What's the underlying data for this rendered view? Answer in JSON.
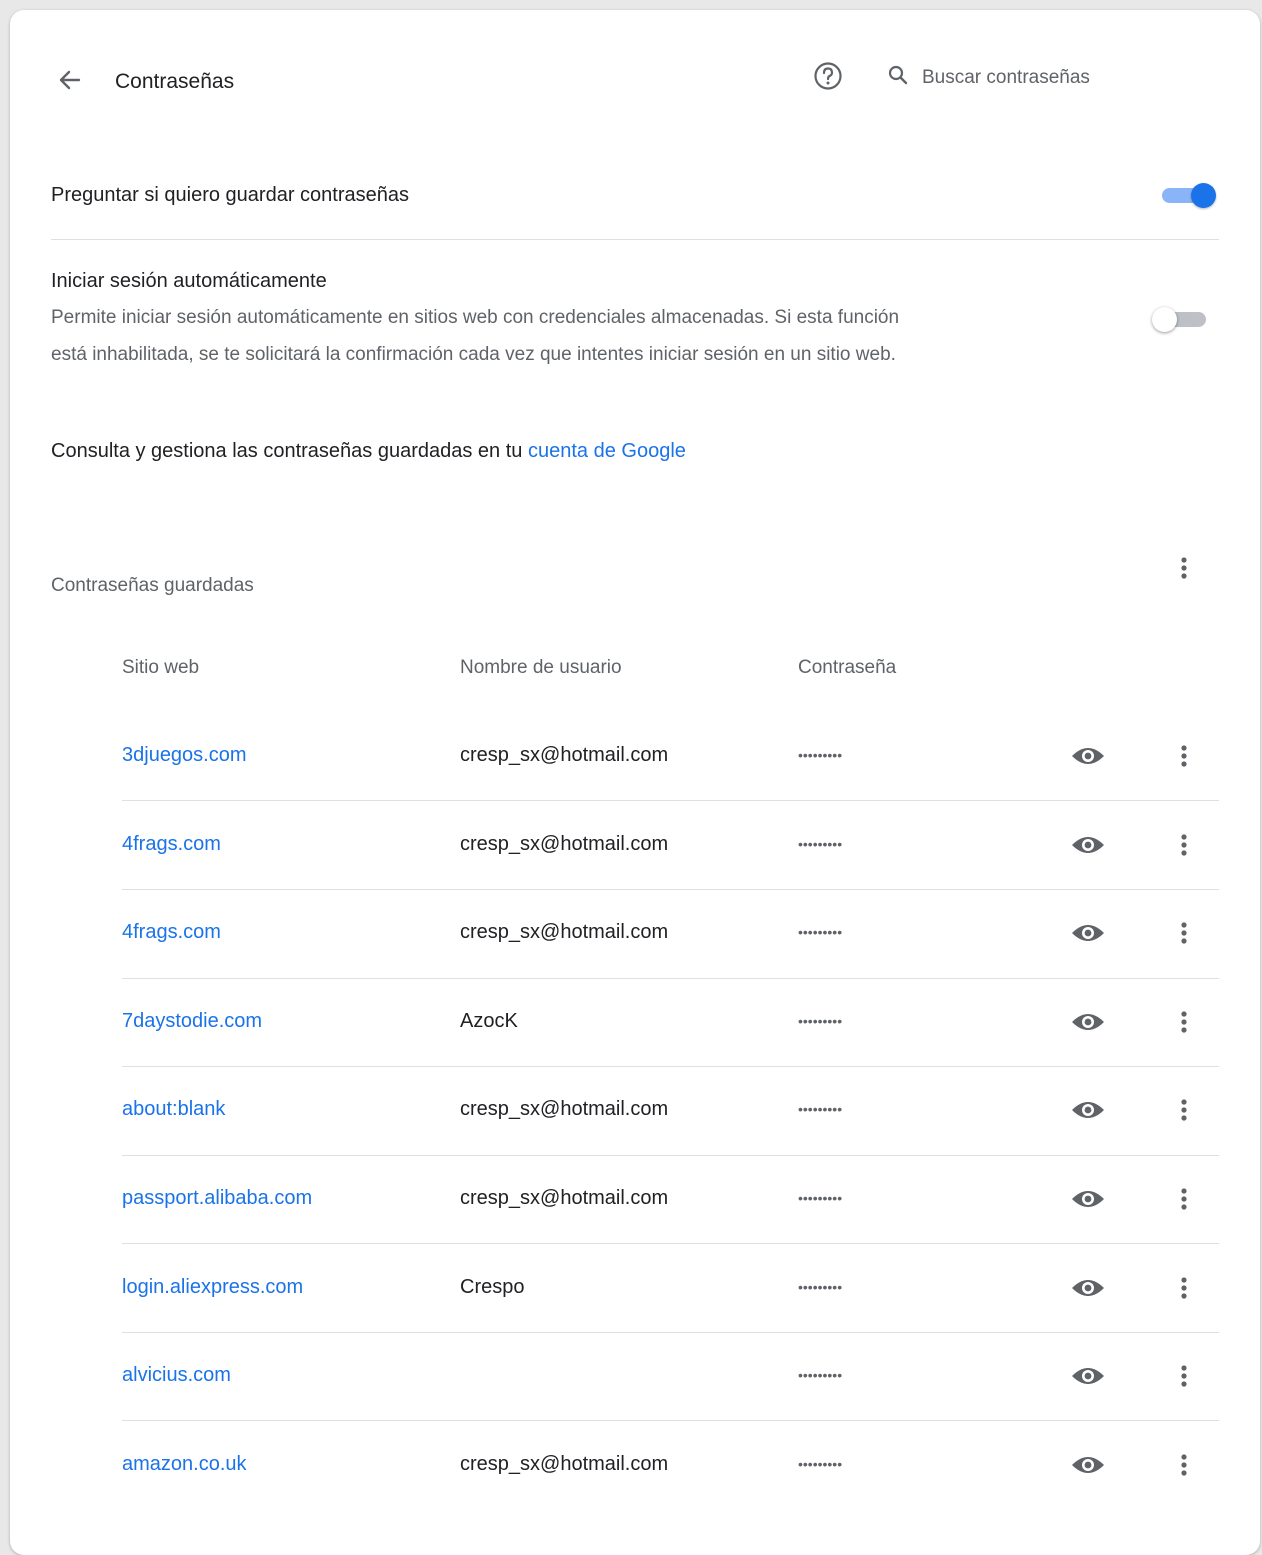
{
  "header": {
    "title": "Contraseñas",
    "search_placeholder": "Buscar contraseñas"
  },
  "settings": {
    "offer_save_label": "Preguntar si quiero guardar contraseñas",
    "offer_save_enabled": true,
    "auto_signin_label": "Iniciar sesión automáticamente",
    "auto_signin_desc_1": "Permite iniciar sesión automáticamente en sitios web con credenciales almacenadas. Si esta función",
    "auto_signin_desc_2": "está inhabilitada, se te solicitará la confirmación cada vez que intentes iniciar sesión en un sitio web.",
    "auto_signin_enabled": false,
    "google_account_text": "Consulta y gestiona las contraseñas guardadas en tu ",
    "google_account_link": "cuenta de Google"
  },
  "saved": {
    "heading": "Contraseñas guardadas",
    "columns": {
      "site": "Sitio web",
      "user": "Nombre de usuario",
      "password": "Contraseña"
    },
    "rows": [
      {
        "site": "3djuegos.com",
        "user": "cresp_sx@hotmail.com",
        "password": "•••••••••"
      },
      {
        "site": "4frags.com",
        "user": "cresp_sx@hotmail.com",
        "password": "•••••••••"
      },
      {
        "site": "4frags.com",
        "user": "cresp_sx@hotmail.com",
        "password": "•••••••••"
      },
      {
        "site": "7daystodie.com",
        "user": "AzocK",
        "password": "•••••••••"
      },
      {
        "site": "about:blank",
        "user": "cresp_sx@hotmail.com",
        "password": "•••••••••"
      },
      {
        "site": "passport.alibaba.com",
        "user": "cresp_sx@hotmail.com",
        "password": "•••••••••"
      },
      {
        "site": "login.aliexpress.com",
        "user": "Crespo",
        "password": "•••••••••"
      },
      {
        "site": "alvicius.com",
        "user": "",
        "password": "•••••••••"
      },
      {
        "site": "amazon.co.uk",
        "user": "cresp_sx@hotmail.com",
        "password": "•••••••••"
      }
    ]
  },
  "icons": {
    "back": "arrow-back-icon",
    "help": "help-circle-icon",
    "search": "search-icon",
    "eye": "eye-icon",
    "more": "more-vert-icon"
  },
  "colors": {
    "accent": "#1a73e8",
    "toggle_track_on": "#8ab4f8",
    "text": "#202124",
    "secondary_text": "#5f6368"
  }
}
